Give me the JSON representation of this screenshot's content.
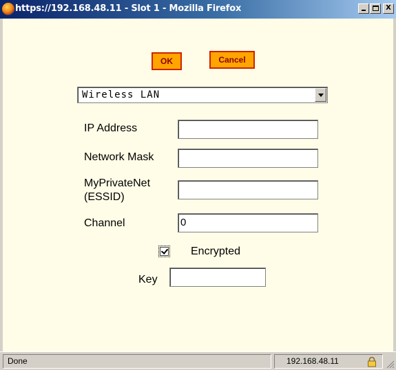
{
  "window": {
    "title": "https://192.168.48.11 - Slot 1 - Mozilla Firefox",
    "minimize_icon": "minimize-icon",
    "maximize_icon": "maximize-icon",
    "close_label": "X"
  },
  "form": {
    "ok_label": "OK",
    "cancel_label": "Cancel",
    "interface_select": "Wireless LAN",
    "ip_address": {
      "label": "IP Address",
      "value": ""
    },
    "network_mask": {
      "label": "Network Mask",
      "value": ""
    },
    "essid": {
      "label_line1": "MyPrivateNet",
      "label_line2": "(ESSID)",
      "value": ""
    },
    "channel": {
      "label": "Channel",
      "value": "0"
    },
    "encrypted": {
      "label": "Encrypted",
      "checked": true
    },
    "key": {
      "label": "Key",
      "value": ""
    }
  },
  "statusbar": {
    "status_text": "Done",
    "host": "192.168.48.11",
    "lock_icon": "padlock-icon"
  },
  "colors": {
    "button_bg": "#ffa500",
    "button_border": "#cc2200",
    "content_bg": "#fffde7"
  }
}
